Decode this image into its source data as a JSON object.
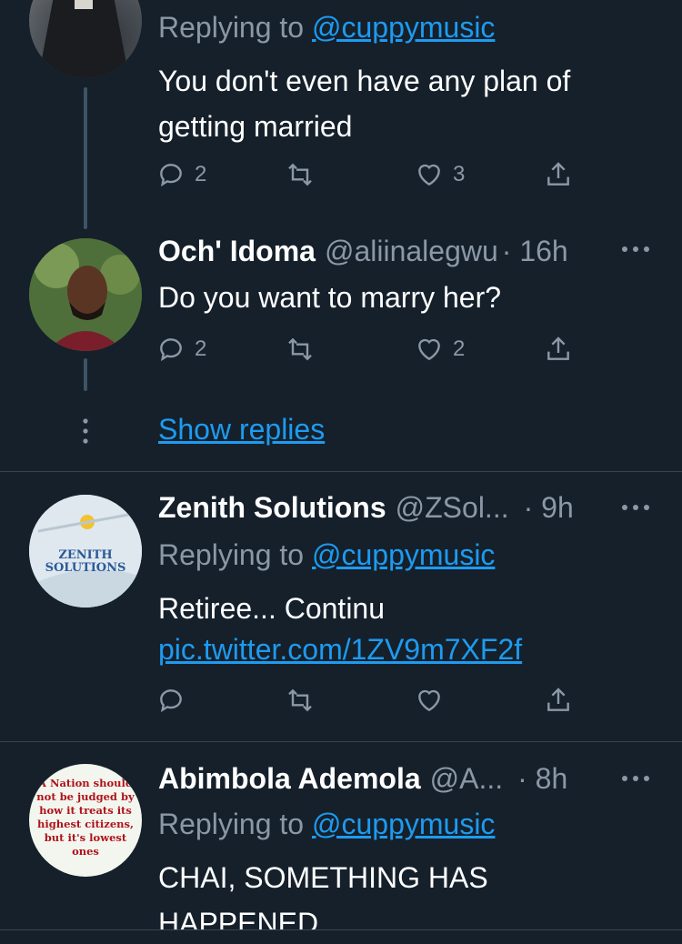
{
  "tweets": [
    {
      "reply_prefix": "Replying to ",
      "reply_mention": "@cuppymusic",
      "text_line1": "You don't even have any plan of",
      "text_line2": "getting married",
      "replies": "2",
      "likes": "3"
    },
    {
      "name": "Och' Idoma",
      "handle": "@aliinalegwu",
      "time": "· 16h",
      "text": "Do you want to marry her?",
      "replies": "2",
      "likes": "2"
    },
    {
      "name": "Zenith Solutions",
      "handle": "@ZSol...",
      "time": "· 9h",
      "reply_prefix": "Replying to ",
      "reply_mention": "@cuppymusic",
      "text": "Retiree... Continu",
      "link": "pic.twitter.com/1ZV9m7XF2f",
      "avatar_text_1": "ZENITH",
      "avatar_text_2": "SOLUTIONS"
    },
    {
      "name": "Abimbola Ademola",
      "handle": "@A...",
      "time": "· 8h",
      "reply_prefix": "Replying to ",
      "reply_mention": "@cuppymusic",
      "text_line1": "CHAI, SOMETHING HAS",
      "text_line2": "HAPPENED",
      "avatar_text": [
        "A Nation should",
        "not be judged by",
        "how it treats its",
        "highest citizens,",
        "but it's lowest",
        "ones"
      ]
    }
  ],
  "show_replies": "Show replies",
  "colors": {
    "background": "#15202b",
    "accent": "#1d9bf0",
    "secondary_text": "#8b98a5",
    "divider": "#38444d"
  },
  "icons": [
    "reply-icon",
    "retweet-icon",
    "like-icon",
    "share-icon",
    "more-icon"
  ]
}
